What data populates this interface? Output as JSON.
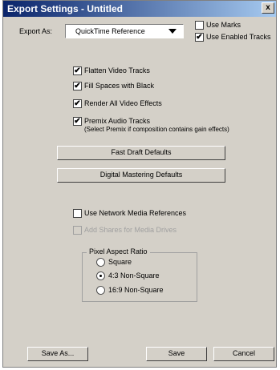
{
  "window": {
    "title": "Export Settings - Untitled",
    "close_label": "x"
  },
  "export_as": {
    "label": "Export As:",
    "value": "QuickTime Reference"
  },
  "top_checks": [
    {
      "label": "Use Marks",
      "checked": false
    },
    {
      "label": "Use Enabled Tracks",
      "checked": true
    }
  ],
  "options": [
    {
      "label": "Flatten Video Tracks",
      "checked": true
    },
    {
      "label": "Fill Spaces with Black",
      "checked": true
    },
    {
      "label": "Render All Video Effects",
      "checked": true
    },
    {
      "label": "Premix Audio Tracks",
      "checked": true
    }
  ],
  "premix_note": "(Select Premix if composition contains gain effects)",
  "buttons": {
    "fast_draft": "Fast Draft Defaults",
    "digital_mastering": "Digital Mastering Defaults",
    "save_as": "Save As...",
    "save": "Save",
    "cancel": "Cancel"
  },
  "network": {
    "use_network": {
      "label": "Use Network Media References",
      "checked": false
    },
    "add_shares": {
      "label": "Add Shares for Media Drives",
      "checked": false,
      "disabled": true
    }
  },
  "pixel_aspect": {
    "title": "Pixel Aspect Ratio",
    "options": [
      {
        "label": "Square",
        "selected": false
      },
      {
        "label": "4:3 Non-Square",
        "selected": true
      },
      {
        "label": "16:9 Non-Square",
        "selected": false
      }
    ]
  }
}
